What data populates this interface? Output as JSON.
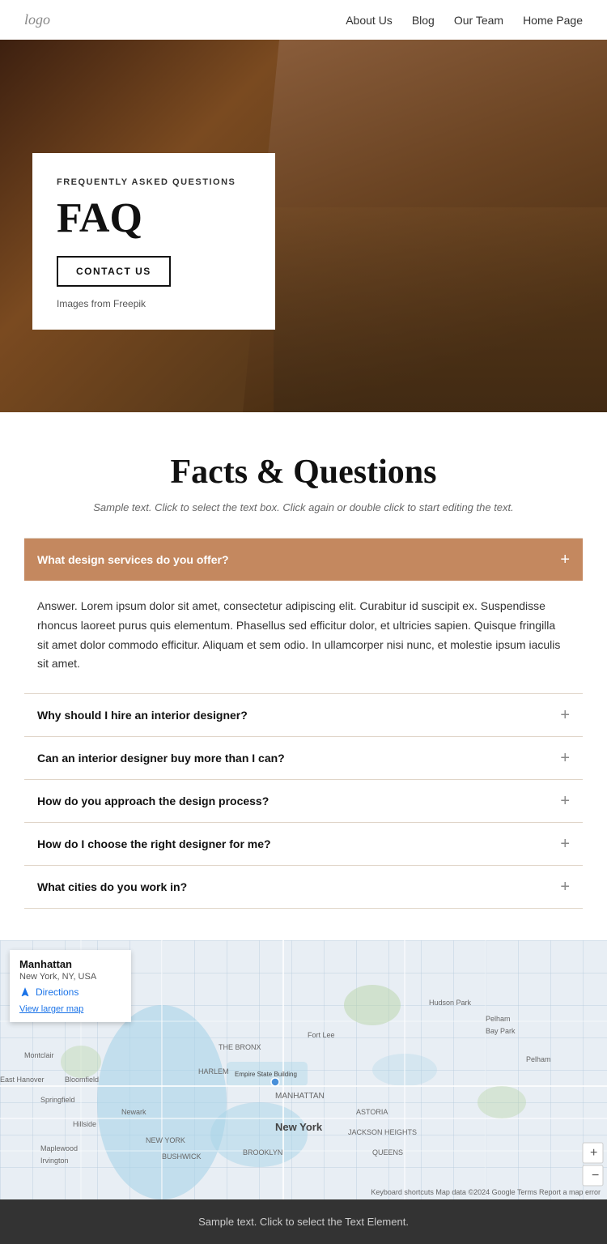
{
  "nav": {
    "logo": "logo",
    "links": [
      "About Us",
      "Blog",
      "Our Team",
      "Home Page"
    ]
  },
  "hero": {
    "subtitle": "FREQUENTLY ASKED QUESTIONS",
    "title": "FAQ",
    "contact_btn": "CONTACT US",
    "image_credit_prefix": "Images from ",
    "image_credit_link": "Freepik"
  },
  "faq_section": {
    "heading": "Facts & Questions",
    "subtext": "Sample text. Click to select the text box. Click again or double click to start editing the text.",
    "items": [
      {
        "question": "What design services do you offer?",
        "answer": "Answer. Lorem ipsum dolor sit amet, consectetur adipiscing elit. Curabitur id suscipit ex. Suspendisse rhoncus laoreet purus quis elementum. Phasellus sed efficitur dolor, et ultricies sapien. Quisque fringilla sit amet dolor commodo efficitur. Aliquam et sem odio. In ullamcorper nisi nunc, et molestie ipsum iaculis sit amet.",
        "active": true
      },
      {
        "question": "Why should I hire an interior designer?",
        "answer": "",
        "active": false
      },
      {
        "question": "Can an interior designer buy more than I can?",
        "answer": "",
        "active": false
      },
      {
        "question": "How do you approach the design process?",
        "answer": "",
        "active": false
      },
      {
        "question": "How do I choose the right designer for me?",
        "answer": "",
        "active": false
      },
      {
        "question": "What cities do you work in?",
        "answer": "",
        "active": false
      }
    ]
  },
  "map": {
    "location_name": "Manhattan",
    "location_address": "New York, NY, USA",
    "directions_label": "Directions",
    "larger_map_label": "View larger map",
    "credits": "Keyboard shortcuts  Map data ©2024 Google  Terms  Report a map error"
  },
  "footer": {
    "text": "Sample text. Click to select the Text Element."
  }
}
